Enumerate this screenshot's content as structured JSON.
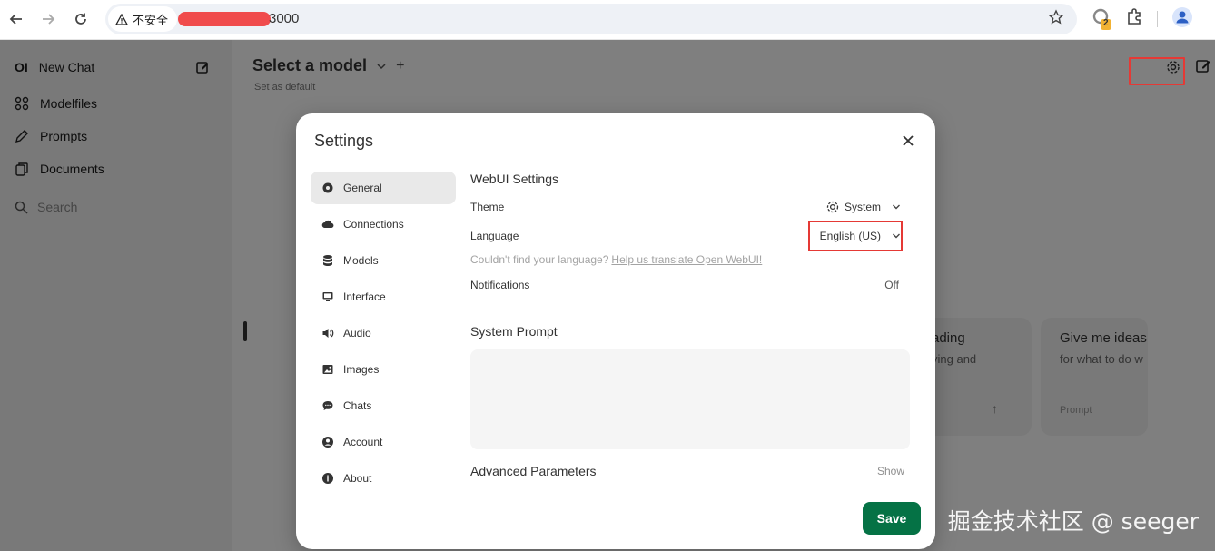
{
  "browser": {
    "security_label": "不安全",
    "url_visible": "3000",
    "extension_badge": "2"
  },
  "sidebar": {
    "logo": "OI",
    "new_chat": "New Chat",
    "items": [
      {
        "label": "Modelfiles",
        "icon": "grid-icon"
      },
      {
        "label": "Prompts",
        "icon": "pencil-icon"
      },
      {
        "label": "Documents",
        "icon": "documents-icon"
      }
    ],
    "search_placeholder": "Search"
  },
  "main": {
    "model_title": "Select a model",
    "set_default": "Set as default",
    "suggestions": [
      {
        "title": "ading",
        "subtitle": "ying and",
        "arrow": "↑"
      },
      {
        "title": "Give me ideas",
        "subtitle": "for what to do w",
        "tag": "Prompt"
      }
    ]
  },
  "settings": {
    "title": "Settings",
    "tabs": [
      {
        "label": "General",
        "icon": "gear-icon",
        "active": true
      },
      {
        "label": "Connections",
        "icon": "cloud-icon"
      },
      {
        "label": "Models",
        "icon": "database-icon"
      },
      {
        "label": "Interface",
        "icon": "monitor-icon"
      },
      {
        "label": "Audio",
        "icon": "speaker-icon"
      },
      {
        "label": "Images",
        "icon": "image-icon"
      },
      {
        "label": "Chats",
        "icon": "chat-icon"
      },
      {
        "label": "Account",
        "icon": "user-icon"
      },
      {
        "label": "About",
        "icon": "info-icon"
      }
    ],
    "webui_heading": "WebUI Settings",
    "theme_label": "Theme",
    "theme_value": "System",
    "language_label": "Language",
    "language_value": "English (US)",
    "language_help": "Couldn't find your language?",
    "language_help_link": "Help us translate Open WebUI!",
    "notifications_label": "Notifications",
    "notifications_value": "Off",
    "system_prompt_heading": "System Prompt",
    "system_prompt_value": "",
    "advanced_heading": "Advanced Parameters",
    "advanced_toggle": "Show",
    "save_label": "Save"
  },
  "watermark": "掘金技术社区 @ seeger",
  "colors": {
    "save_button": "#057245",
    "highlight_border": "#e53935",
    "overlay": "rgba(0,0,0,0.5)"
  }
}
